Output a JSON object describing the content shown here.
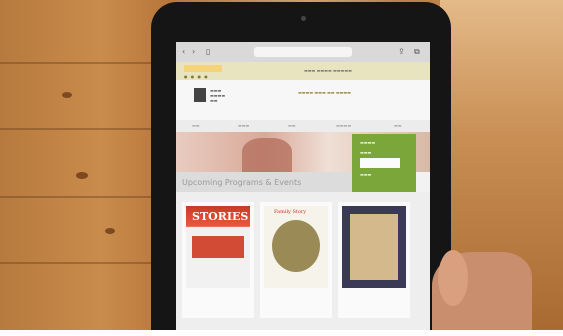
{
  "photo": {
    "subject": "tablet",
    "colors": {
      "wood": "#c98c4c",
      "bezel": "#151515",
      "accent": "#7ba73a",
      "button": "#f0c040"
    }
  },
  "browser": {
    "url": "",
    "icons": [
      "back-icon",
      "forward-icon",
      "bookmarks-icon",
      "share-icon",
      "tabs-icon"
    ]
  },
  "site": {
    "search_label": "",
    "section_title": "Upcoming Programs & Events",
    "login_button": "",
    "cards": [
      {
        "title": "STORIES",
        "caption": ""
      },
      {
        "title": "Family Story",
        "caption": ""
      },
      {
        "title": "",
        "caption": ""
      }
    ]
  }
}
